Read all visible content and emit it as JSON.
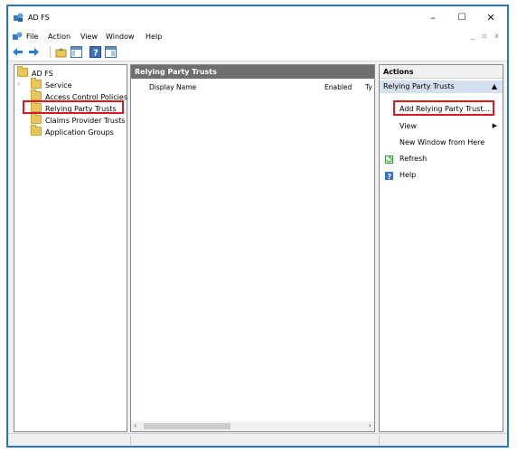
{
  "window": {
    "title": "AD FS"
  },
  "title_controls": {
    "minimize": "–",
    "maximize": "☐",
    "close": "✕"
  },
  "menu": [
    "File",
    "Action",
    "View",
    "Window",
    "Help"
  ],
  "mdi_controls": "_ ▫ x",
  "toolbar": [
    "back-icon",
    "forward-icon",
    "up-folder-icon",
    "show-hide-tree-icon",
    "help-icon",
    "show-hide-action-pane-icon"
  ],
  "tree": {
    "root": "AD FS",
    "items": [
      "Service",
      "Access Control Policies",
      "Relying Party Trusts",
      "Claims Provider Trusts",
      "Application Groups"
    ],
    "expander": "›"
  },
  "center": {
    "title": "Relying Party Trusts",
    "columns": [
      "Display Name",
      "Enabled",
      "Ty"
    ],
    "scroll_left": "‹",
    "scroll_right": "›"
  },
  "actions": {
    "title": "Actions",
    "section": "Relying Party Trusts",
    "items": [
      "Add Relying Party Trust...",
      "View",
      "New Window from Here",
      "Refresh",
      "Help"
    ],
    "collapse": "▲",
    "submenu": "▶"
  },
  "colors": {
    "highlight": "#d71920",
    "header": "#6e6e6e",
    "section": "#d4e0f0",
    "border": "#1f6fbf"
  }
}
